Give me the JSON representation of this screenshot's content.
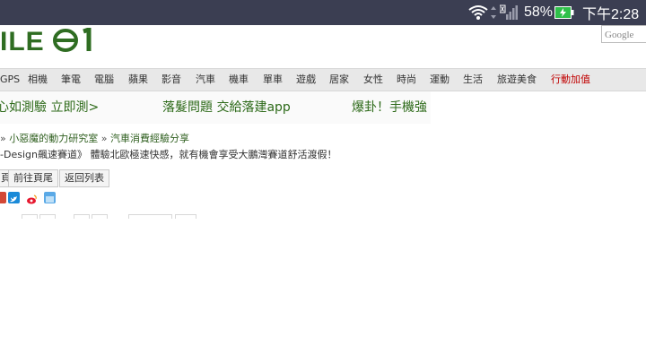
{
  "status_bar": {
    "battery_percent": "58%",
    "time": "下午2:28"
  },
  "header": {
    "logo_text": "ILE",
    "google_label": "Google"
  },
  "nav": {
    "items": [
      "GPS",
      "相機",
      "筆電",
      "電腦",
      "蘋果",
      "影音",
      "汽車",
      "機車",
      "單車",
      "遊戲",
      "居家",
      "女性",
      "時尚",
      "運動",
      "生活",
      "旅遊美食",
      "行動加值"
    ]
  },
  "ad": {
    "items": [
      "心如測驗 立即測>",
      "落髮問題 交給落建app",
      "爆卦！手機強"
    ]
  },
  "breadcrumb": {
    "sep1": "»",
    "item1": "小惡魔的動力研究室",
    "sep2": "»",
    "item2": "汽車消費經驗分享"
  },
  "topic": {
    "title": "-Design飆速賽道》 體驗北歐極速快感，就有機會享受大鵬灣賽道舒活渡假！"
  },
  "buttons": {
    "first": "頁",
    "last_page": "前往頁尾",
    "back_list": "返回列表"
  },
  "share_icons": [
    "gplus-icon",
    "twitter-icon",
    "weibo-icon",
    "plurk-icon"
  ],
  "colors": {
    "status_bar": "#3b3e52",
    "accent_green": "#2d6a19",
    "nav_highlight": "#c00000"
  }
}
